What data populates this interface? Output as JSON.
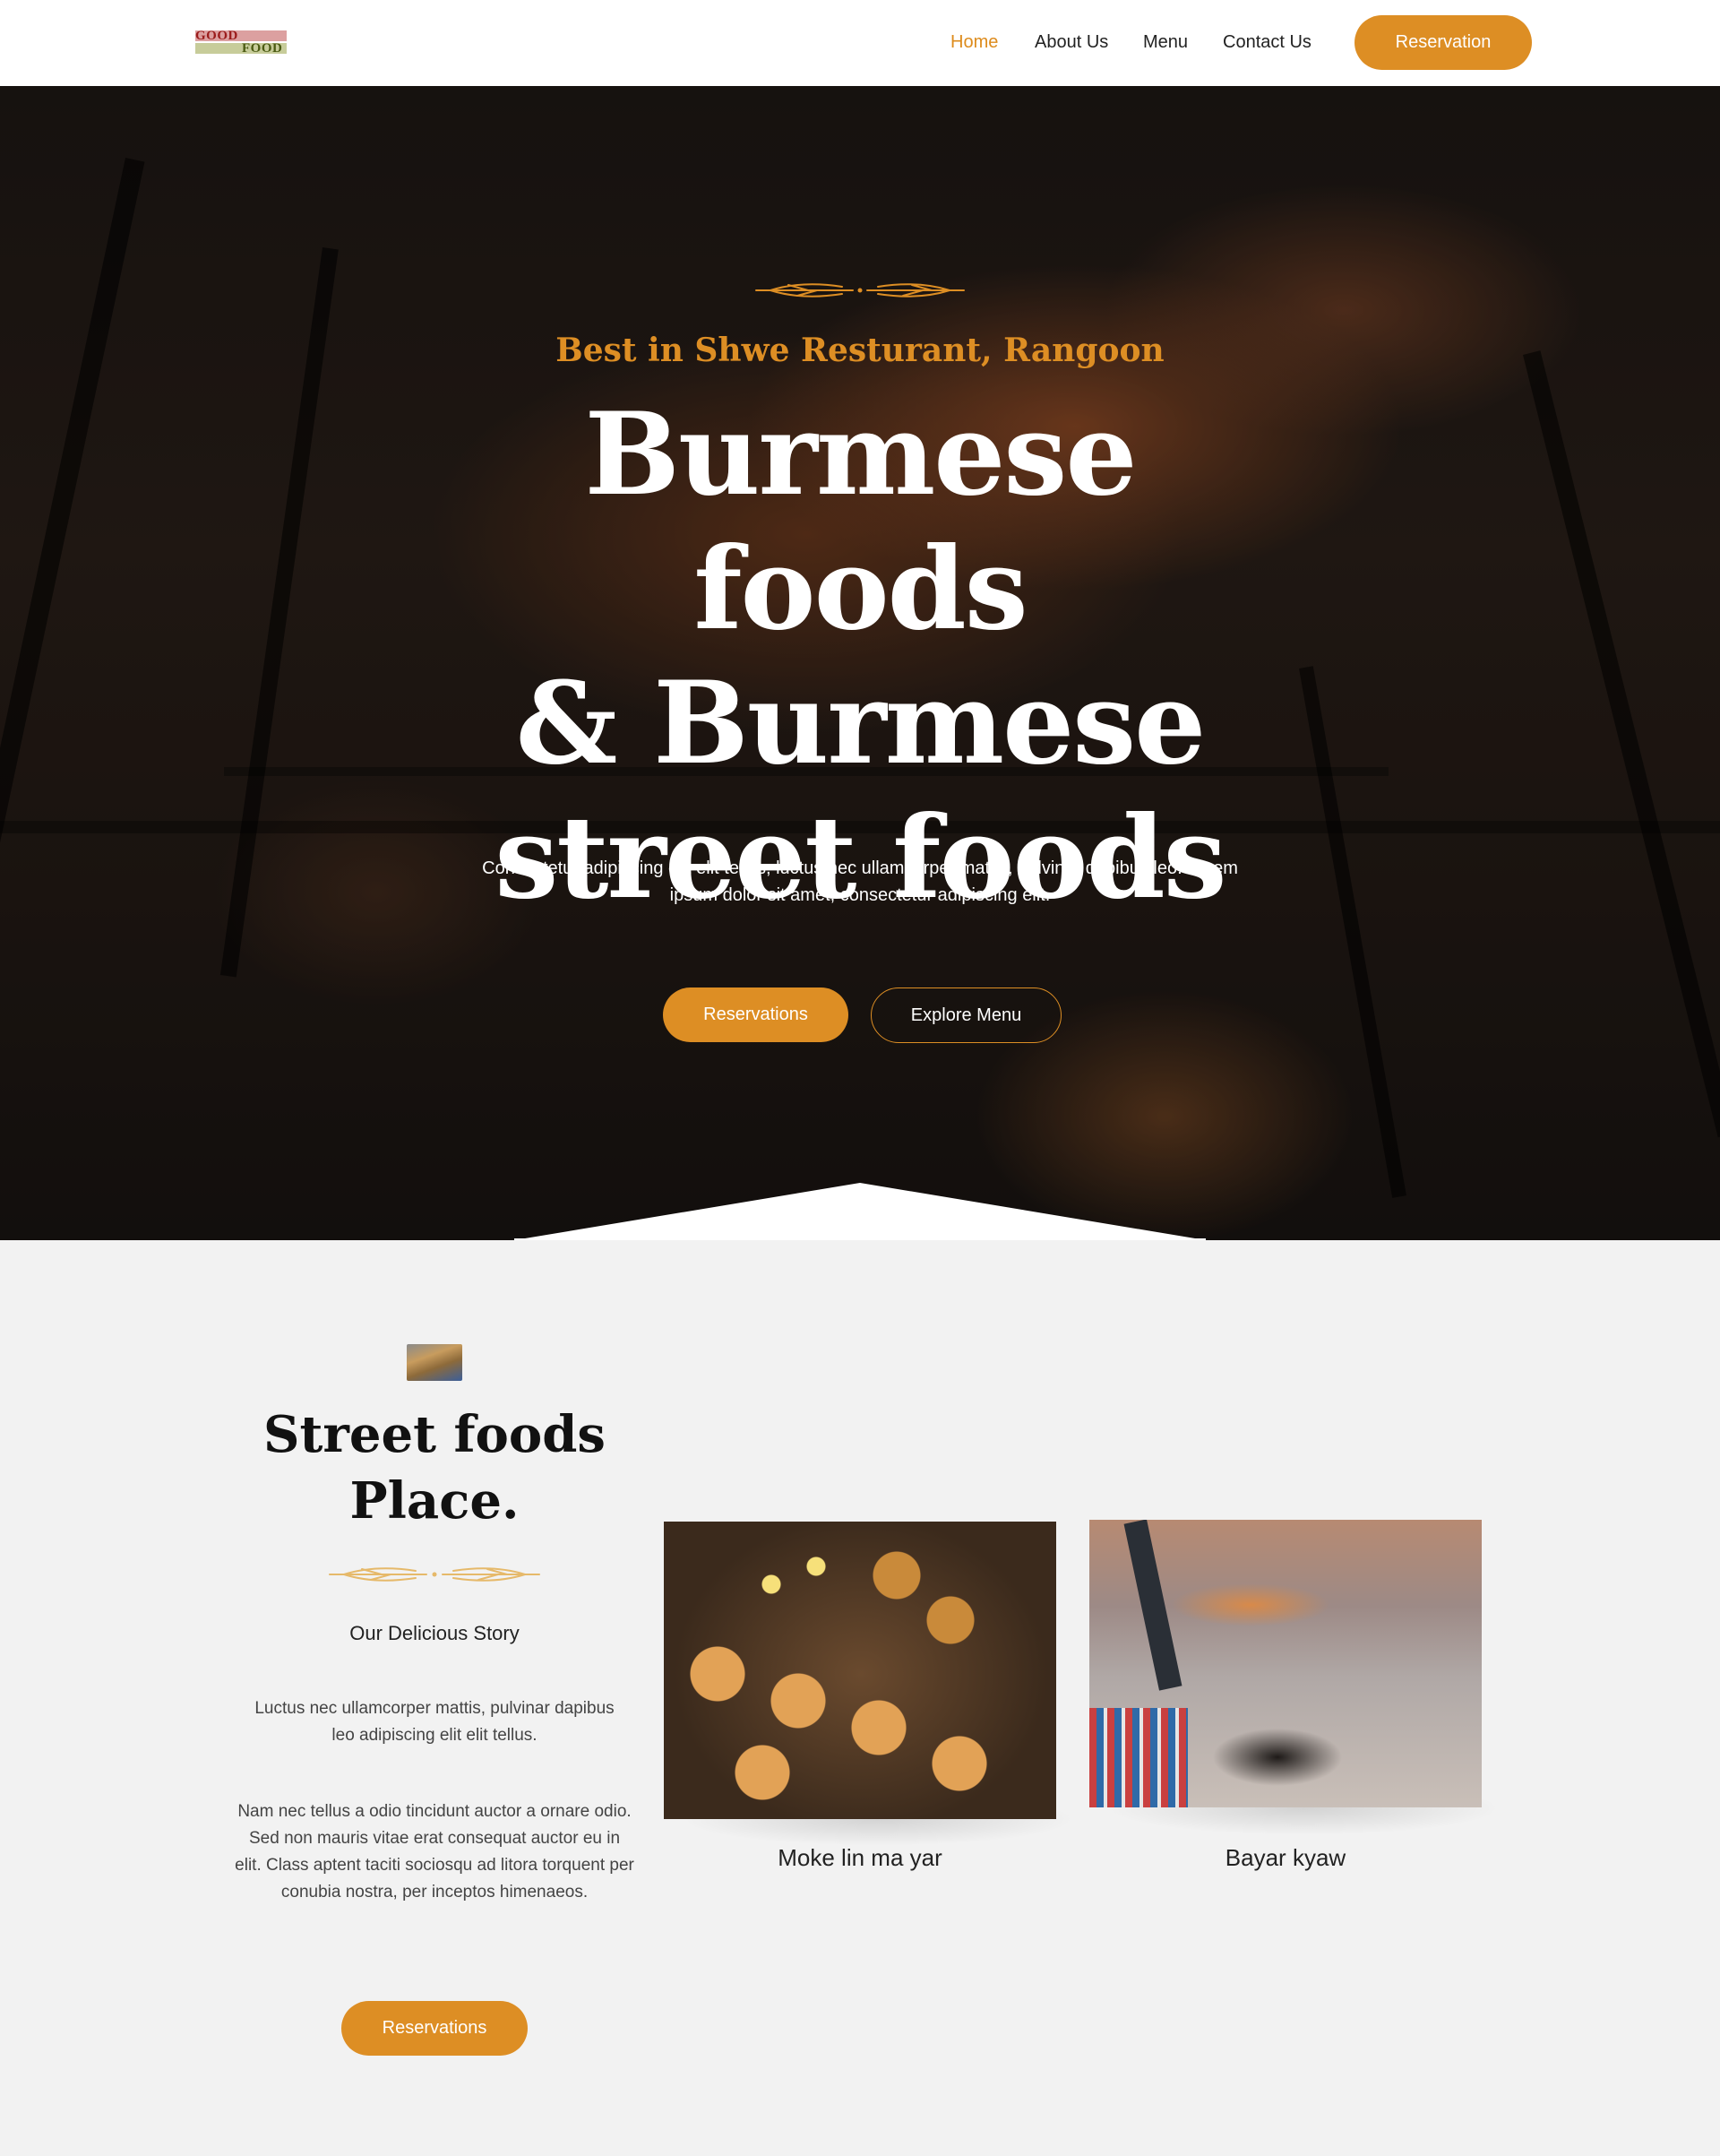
{
  "header": {
    "logo_top": "GOOD",
    "logo_bottom": "FOOD",
    "nav": [
      {
        "label": "Home",
        "active": true
      },
      {
        "label": "About Us",
        "active": false
      },
      {
        "label": "Menu",
        "active": false
      },
      {
        "label": "Contact Us",
        "active": false
      }
    ],
    "cta_label": "Reservation"
  },
  "hero": {
    "subtitle": "Best in Shwe Resturant, Rangoon",
    "title_line1": "Burmese foods",
    "title_line2": "& Burmese",
    "title_line3": "street foods",
    "description_line1": "Consectetur adipiscing elit elit tellus, luctus nec ullamcorper mattis, pulvinar dapibus leo. Lorem",
    "description_line2": "ipsum dolor sit amet, consectetur adipiscing elit.",
    "primary_button": "Reservations",
    "secondary_button": "Explore Menu"
  },
  "story": {
    "title_line1": "Street foods",
    "title_line2": "Place.",
    "subtitle": "Our Delicious Story",
    "paragraph1": "Luctus nec ullamcorper mattis, pulvinar dapibus leo adipiscing elit elit tellus.",
    "paragraph2": "Nam nec tellus a odio tincidunt auctor a ornare odio. Sed non mauris vitae erat consequat auctor eu in elit. Class aptent taciti sociosqu ad litora torquent per conubia nostra, per inceptos himenaeos.",
    "button": "Reservations"
  },
  "foods": [
    {
      "name": "Moke lin ma yar"
    },
    {
      "name": "Bayar kyaw"
    }
  ],
  "colors": {
    "accent": "#dd8e24",
    "header_bg": "#ffffff",
    "section_bg": "#f2f2f2",
    "text_dark": "#111111"
  }
}
